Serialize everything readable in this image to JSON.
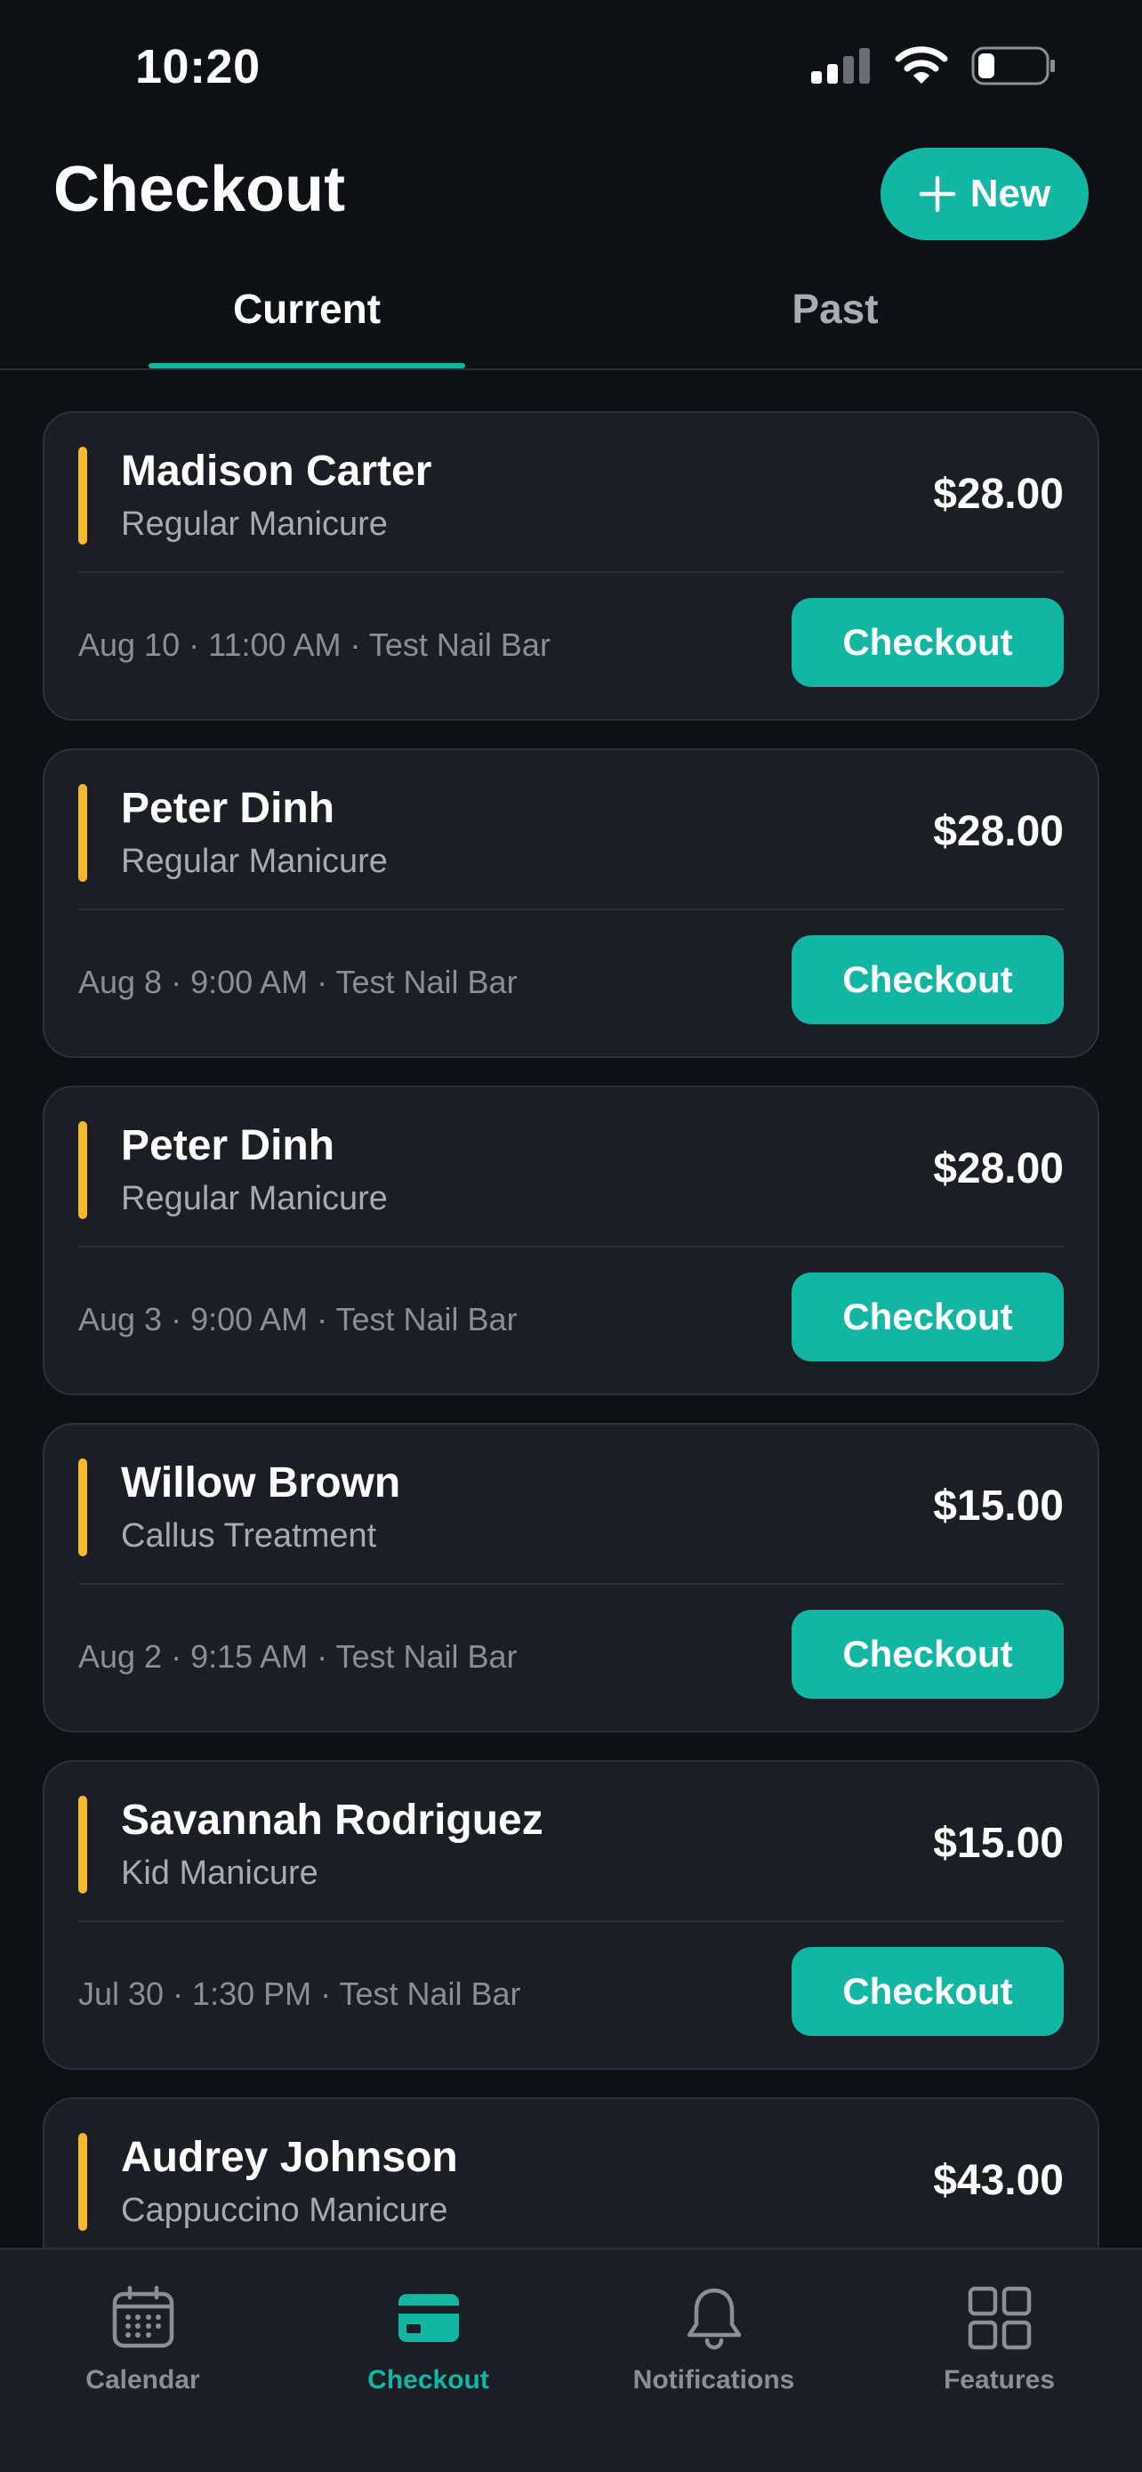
{
  "status_bar": {
    "time": "10:20"
  },
  "header": {
    "title": "Checkout",
    "new_button_label": "New"
  },
  "tabs": [
    {
      "label": "Current",
      "active": true
    },
    {
      "label": "Past",
      "active": false
    }
  ],
  "appointments": [
    {
      "client": "Madison Carter",
      "service": "Regular Manicure",
      "price": "$28.00",
      "meta": "Aug 10 · 11:00 AM · Test Nail Bar",
      "action": "Checkout"
    },
    {
      "client": "Peter Dinh",
      "service": "Regular Manicure",
      "price": "$28.00",
      "meta": "Aug 8 · 9:00 AM · Test Nail Bar",
      "action": "Checkout"
    },
    {
      "client": "Peter Dinh",
      "service": "Regular Manicure",
      "price": "$28.00",
      "meta": "Aug 3 · 9:00 AM · Test Nail Bar",
      "action": "Checkout"
    },
    {
      "client": "Willow Brown",
      "service": "Callus Treatment",
      "price": "$15.00",
      "meta": "Aug 2 · 9:15 AM · Test Nail Bar",
      "action": "Checkout"
    },
    {
      "client": "Savannah Rodriguez",
      "service": "Kid Manicure",
      "price": "$15.00",
      "meta": "Jul 30 · 1:30 PM · Test Nail Bar",
      "action": "Checkout"
    },
    {
      "client": "Audrey Johnson",
      "service": "Cappuccino Manicure",
      "price": "$43.00",
      "meta": "",
      "action": ""
    }
  ],
  "bottom_nav": [
    {
      "label": "Calendar",
      "icon": "calendar-icon",
      "active": false
    },
    {
      "label": "Checkout",
      "icon": "credit-card-icon",
      "active": true
    },
    {
      "label": "Notifications",
      "icon": "bell-icon",
      "active": false
    },
    {
      "label": "Features",
      "icon": "grid-icon",
      "active": false
    }
  ],
  "colors": {
    "background": "#0d1014",
    "card": "#1b1f25",
    "accent": "#13b5a3",
    "status_bar_accent": "#f5b82e"
  }
}
